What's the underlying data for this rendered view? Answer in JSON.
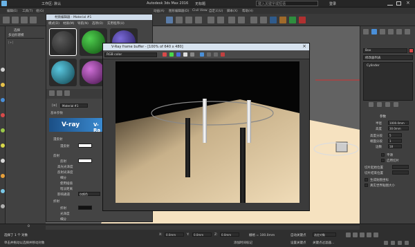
{
  "window": {
    "title": "Autodesk 3ds Max 2016",
    "file": "无标题",
    "workspace": "工作区: 默认",
    "search_placeholder": "键入关键字或短语",
    "login": "登录"
  },
  "menu": [
    "编辑(E)",
    "工具(T)",
    "组(G)",
    "视图(V)",
    "创建(C)",
    "修改器(M)",
    "动画(A)",
    "图形编辑器(D)",
    "渲染(R)",
    "Civil View",
    "自定义(U)",
    "脚本(X)",
    "帮助(H)"
  ],
  "scene_explorer": {
    "label": "选择",
    "sub": "多边形建模"
  },
  "material_editor": {
    "title": "材质编辑器 - Material #1",
    "menus": [
      "模式(D)",
      "材质(M)",
      "导航(N)",
      "选项(O)",
      "实用程序(U)"
    ],
    "material_name": "Material #1",
    "rollout_basic": "基本参数",
    "vray_logo": "V-ray",
    "vray_logo_suffix": "V-Ra",
    "sections": [
      {
        "title": "漫反射",
        "rows": [
          {
            "label": "漫反射"
          }
        ]
      },
      {
        "title": "反射",
        "rows": [
          {
            "label": "反射"
          },
          {
            "label": "高光光泽度"
          },
          {
            "label": "反射光泽度"
          },
          {
            "label": "细分"
          },
          {
            "label": "使用插值"
          },
          {
            "label": "暗淡距离"
          },
          {
            "label": "影响通道",
            "value": "仅颜色"
          }
        ]
      },
      {
        "title": "折射",
        "rows": [
          {
            "label": "折射"
          },
          {
            "label": "光泽度"
          },
          {
            "label": "细分"
          },
          {
            "label": "使用插值"
          }
        ]
      }
    ],
    "bottom_label": "烟雾颜色",
    "swatch_colors": {
      "s1": "#2c2c2c",
      "s2": "#1e7b1e",
      "s3": "#3d2b8a",
      "s4": "#1f6f82",
      "s5": "#7a2a80"
    }
  },
  "vfb": {
    "title": "V-Ray frame buffer - [100% of 640 x 480]",
    "channel": "RGB color"
  },
  "right_panel": {
    "object_name": "Box",
    "modifier_list": "修改器列表",
    "stack_item": "Cylinder",
    "params_title": "参数",
    "params": [
      {
        "label": "半径",
        "value": "1000.0mm"
      },
      {
        "label": "高度",
        "value": "30.0mm"
      },
      {
        "label": "高度分段",
        "value": "5"
      },
      {
        "label": "端面分段",
        "value": "1"
      },
      {
        "label": "边数",
        "value": "18"
      }
    ],
    "smooth": "平滑",
    "slice_on": "启用切片",
    "slice_from": "切片起始位置",
    "slice_to": "切片结束位置",
    "gen_coords": "生成贴图坐标",
    "real_world": "真实世界贴图大小"
  },
  "status": {
    "selected": "选择了 1 个 对象",
    "hint": "单击并拖动以选择并移动对象",
    "x": "0.0mm",
    "y": "0.0mm",
    "z": "0.0mm",
    "grid": "栅格 = 100.0mm",
    "auto_key": "自动关键点",
    "selection_set": "选定对象",
    "set_key": "设置关键点",
    "key_filter": "关键点过滤器...",
    "add_time_tag": "添加时间标记",
    "frame": "0",
    "frame_total": "100",
    "timeline_marks": [
      "0",
      "10",
      "20",
      "30",
      "40",
      "50",
      "60",
      "70",
      "80",
      "90",
      "100"
    ]
  }
}
